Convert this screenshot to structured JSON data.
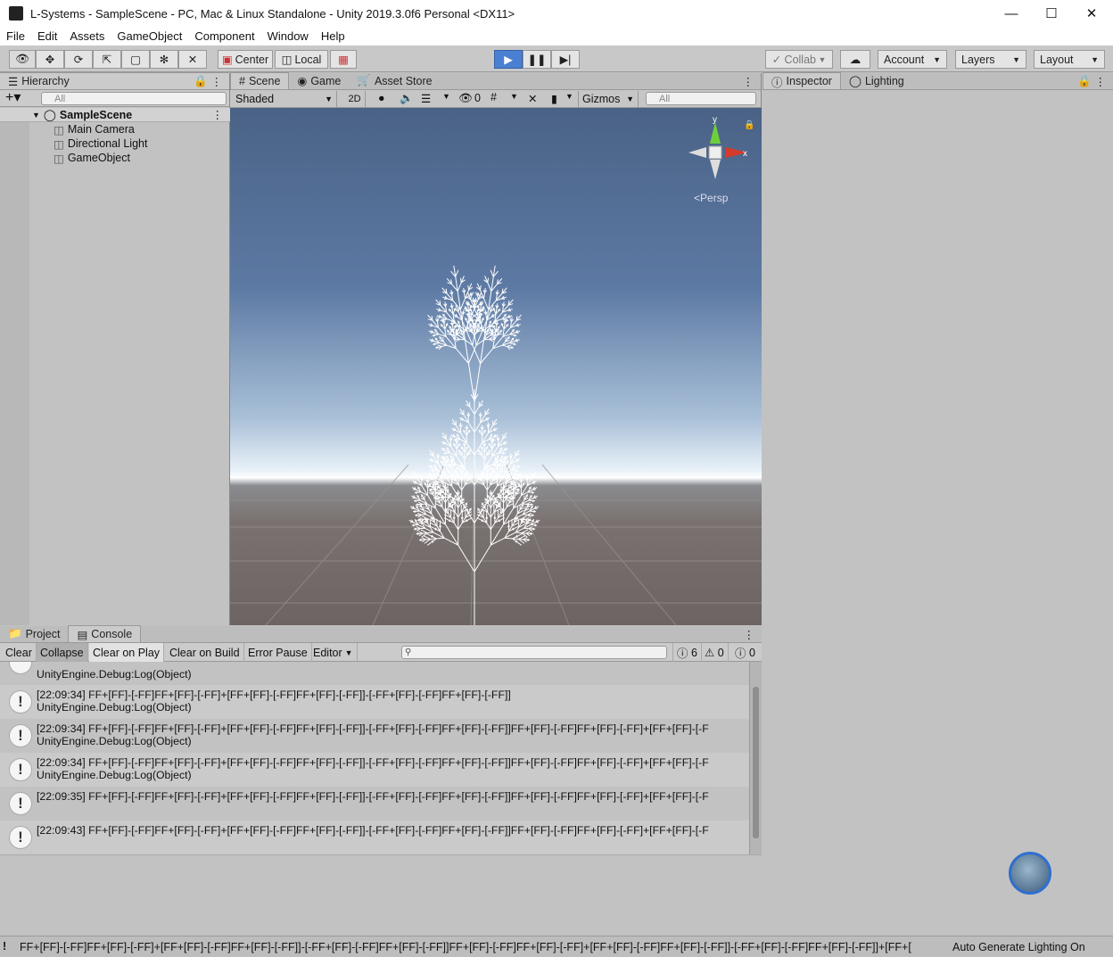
{
  "window": {
    "title": "L-Systems - SampleScene - PC, Mac & Linux Standalone - Unity 2019.3.0f6 Personal <DX11>"
  },
  "menu": [
    "File",
    "Edit",
    "Assets",
    "GameObject",
    "Component",
    "Window",
    "Help"
  ],
  "toolbar": {
    "center": "Center",
    "local": "Local",
    "collab": "Collab",
    "account": "Account",
    "layers": "Layers",
    "layout": "Layout"
  },
  "hierarchy": {
    "tab": "Hierarchy",
    "search_placeholder": "All",
    "scene": "SampleScene",
    "items": [
      "Main Camera",
      "Directional Light",
      "GameObject"
    ]
  },
  "scene_panel": {
    "tabs": [
      "Scene",
      "Game",
      "Asset Store"
    ],
    "shading": "Shaded",
    "mode_2d": "2D",
    "hidden_count": "0",
    "gizmos": "Gizmos",
    "search_placeholder": "All",
    "persp": "Persp",
    "axis_x": "x",
    "axis_y": "y"
  },
  "inspector": {
    "tabs": [
      "Inspector",
      "Lighting"
    ]
  },
  "console": {
    "tabs": [
      "Project",
      "Console"
    ],
    "buttons": [
      "Clear",
      "Collapse",
      "Clear on Play",
      "Clear on Build",
      "Error Pause",
      "Editor"
    ],
    "log_count": "6",
    "warn_count": "0",
    "error_count": "0",
    "first_row_partial": "UnityEngine.Debug:Log(Object)",
    "logs": [
      {
        "line1": "[22:09:34] FF+[FF]-[-FF]FF+[FF]-[-FF]+[FF+[FF]-[-FF]FF+[FF]-[-FF]]-[-FF+[FF]-[-FF]FF+[FF]-[-FF]]",
        "line2": "UnityEngine.Debug:Log(Object)"
      },
      {
        "line1": "[22:09:34] FF+[FF]-[-FF]FF+[FF]-[-FF]+[FF+[FF]-[-FF]FF+[FF]-[-FF]]-[-FF+[FF]-[-FF]FF+[FF]-[-FF]]FF+[FF]-[-FF]FF+[FF]-[-FF]+[FF+[FF]-[-F",
        "line2": "UnityEngine.Debug:Log(Object)"
      },
      {
        "line1": "[22:09:34] FF+[FF]-[-FF]FF+[FF]-[-FF]+[FF+[FF]-[-FF]FF+[FF]-[-FF]]-[-FF+[FF]-[-FF]FF+[FF]-[-FF]]FF+[FF]-[-FF]FF+[FF]-[-FF]+[FF+[FF]-[-F",
        "line2": "UnityEngine.Debug:Log(Object)"
      },
      {
        "line1": "[22:09:35] FF+[FF]-[-FF]FF+[FF]-[-FF]+[FF+[FF]-[-FF]FF+[FF]-[-FF]]-[-FF+[FF]-[-FF]FF+[FF]-[-FF]]FF+[FF]-[-FF]FF+[FF]-[-FF]+[FF+[FF]-[-F",
        "line2": ""
      },
      {
        "line1": "[22:09:43] FF+[FF]-[-FF]FF+[FF]-[-FF]+[FF+[FF]-[-FF]FF+[FF]-[-FF]]-[-FF+[FF]-[-FF]FF+[FF]-[-FF]]FF+[FF]-[-FF]FF+[FF]-[-FF]+[FF+[FF]-[-F",
        "line2": ""
      }
    ]
  },
  "status": {
    "message": "FF+[FF]-[-FF]FF+[FF]-[-FF]+[FF+[FF]-[-FF]FF+[FF]-[-FF]]-[-FF+[FF]-[-FF]FF+[FF]-[-FF]]FF+[FF]-[-FF]FF+[FF]-[-FF]+[FF+[FF]-[-FF]FF+[FF]-[-FF]]-[-FF+[FF]-[-FF]FF+[FF]-[-FF]]+[FF+[",
    "lighting": "Auto Generate Lighting On"
  }
}
